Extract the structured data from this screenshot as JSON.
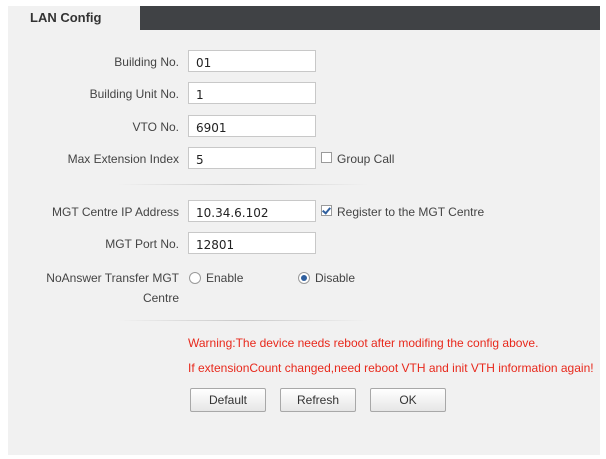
{
  "tab": {
    "label": "LAN Config"
  },
  "fields": {
    "building_no": {
      "label": "Building No.",
      "value": "01"
    },
    "building_unit_no": {
      "label": "Building Unit No.",
      "value": "1"
    },
    "vto_no": {
      "label": "VTO No.",
      "value": "6901"
    },
    "max_extension_index": {
      "label": "Max Extension Index",
      "value": "5"
    },
    "group_call": {
      "label": "Group Call",
      "checked": false
    },
    "mgt_centre_ip": {
      "label": "MGT Centre IP Address",
      "value": "10.34.6.102"
    },
    "register_mgt": {
      "label": "Register to the MGT Centre",
      "checked": true
    },
    "mgt_port_no": {
      "label": "MGT Port No.",
      "value": "12801"
    },
    "noanswer_transfer": {
      "label_line1": "NoAnswer Transfer MGT",
      "label_line2": "Centre",
      "enable_label": "Enable",
      "disable_label": "Disable",
      "selected": "Disable"
    }
  },
  "warnings": {
    "line1": "Warning:The device needs reboot after modifing the config above.",
    "line2": "If extensionCount changed,need reboot VTH and init VTH information again!"
  },
  "buttons": {
    "default_label": "Default",
    "refresh_label": "Refresh",
    "ok_label": "OK"
  },
  "colors": {
    "tabbar": "#404245",
    "panel": "#f1f1f1",
    "warning": "#e8291c",
    "accent": "#2f5f9e"
  }
}
